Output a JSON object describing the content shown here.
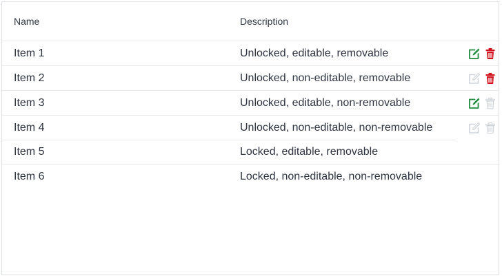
{
  "grid": {
    "columns": {
      "name": "Name",
      "description": "Description"
    },
    "rows": [
      {
        "name": "Item 1",
        "description": "Unlocked, editable, removable",
        "locked": false,
        "editable": true,
        "removable": true
      },
      {
        "name": "Item 2",
        "description": "Unlocked, non-editable, removable",
        "locked": false,
        "editable": false,
        "removable": true
      },
      {
        "name": "Item 3",
        "description": "Unlocked, editable, non-removable",
        "locked": false,
        "editable": true,
        "removable": false
      },
      {
        "name": "Item 4",
        "description": "Unlocked, non-editable, non-removable",
        "locked": false,
        "editable": false,
        "removable": false
      },
      {
        "name": "Item 5",
        "description": "Locked, editable, removable",
        "locked": true,
        "editable": true,
        "removable": true
      },
      {
        "name": "Item 6",
        "description": "Locked, non-editable, non-removable",
        "locked": true,
        "editable": false,
        "removable": false
      }
    ]
  },
  "icons": {
    "edit": "edit-icon",
    "delete": "trash-icon"
  },
  "colors": {
    "edit_enabled": "#1e8a3c",
    "delete_enabled": "#d0101b",
    "disabled": "#cfd3d8",
    "row_border": "#e6e8eb",
    "panel_border": "#dcdfe4",
    "text": "#2e3440"
  }
}
